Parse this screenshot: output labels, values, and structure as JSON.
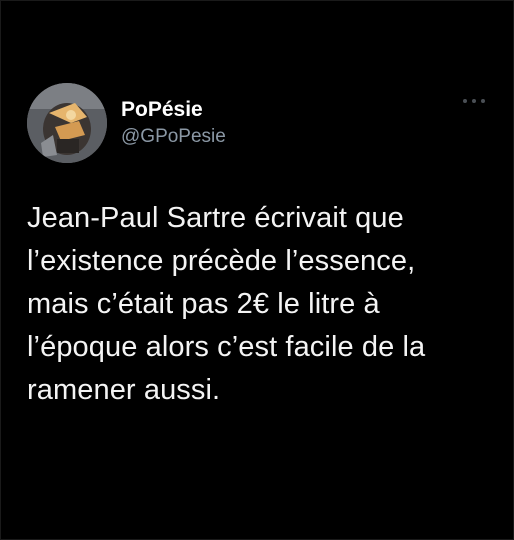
{
  "tweet": {
    "author": {
      "display_name": "PoPésie",
      "handle": "@GPoPesie"
    },
    "more_icon": "more-horizontal-icon",
    "text": "Jean-Paul Sartre écrivait que\nl’existence précède l’essence,\nmais c’était pas 2€ le litre à\nl’époque alors c’est facile de la\nramener aussi."
  }
}
